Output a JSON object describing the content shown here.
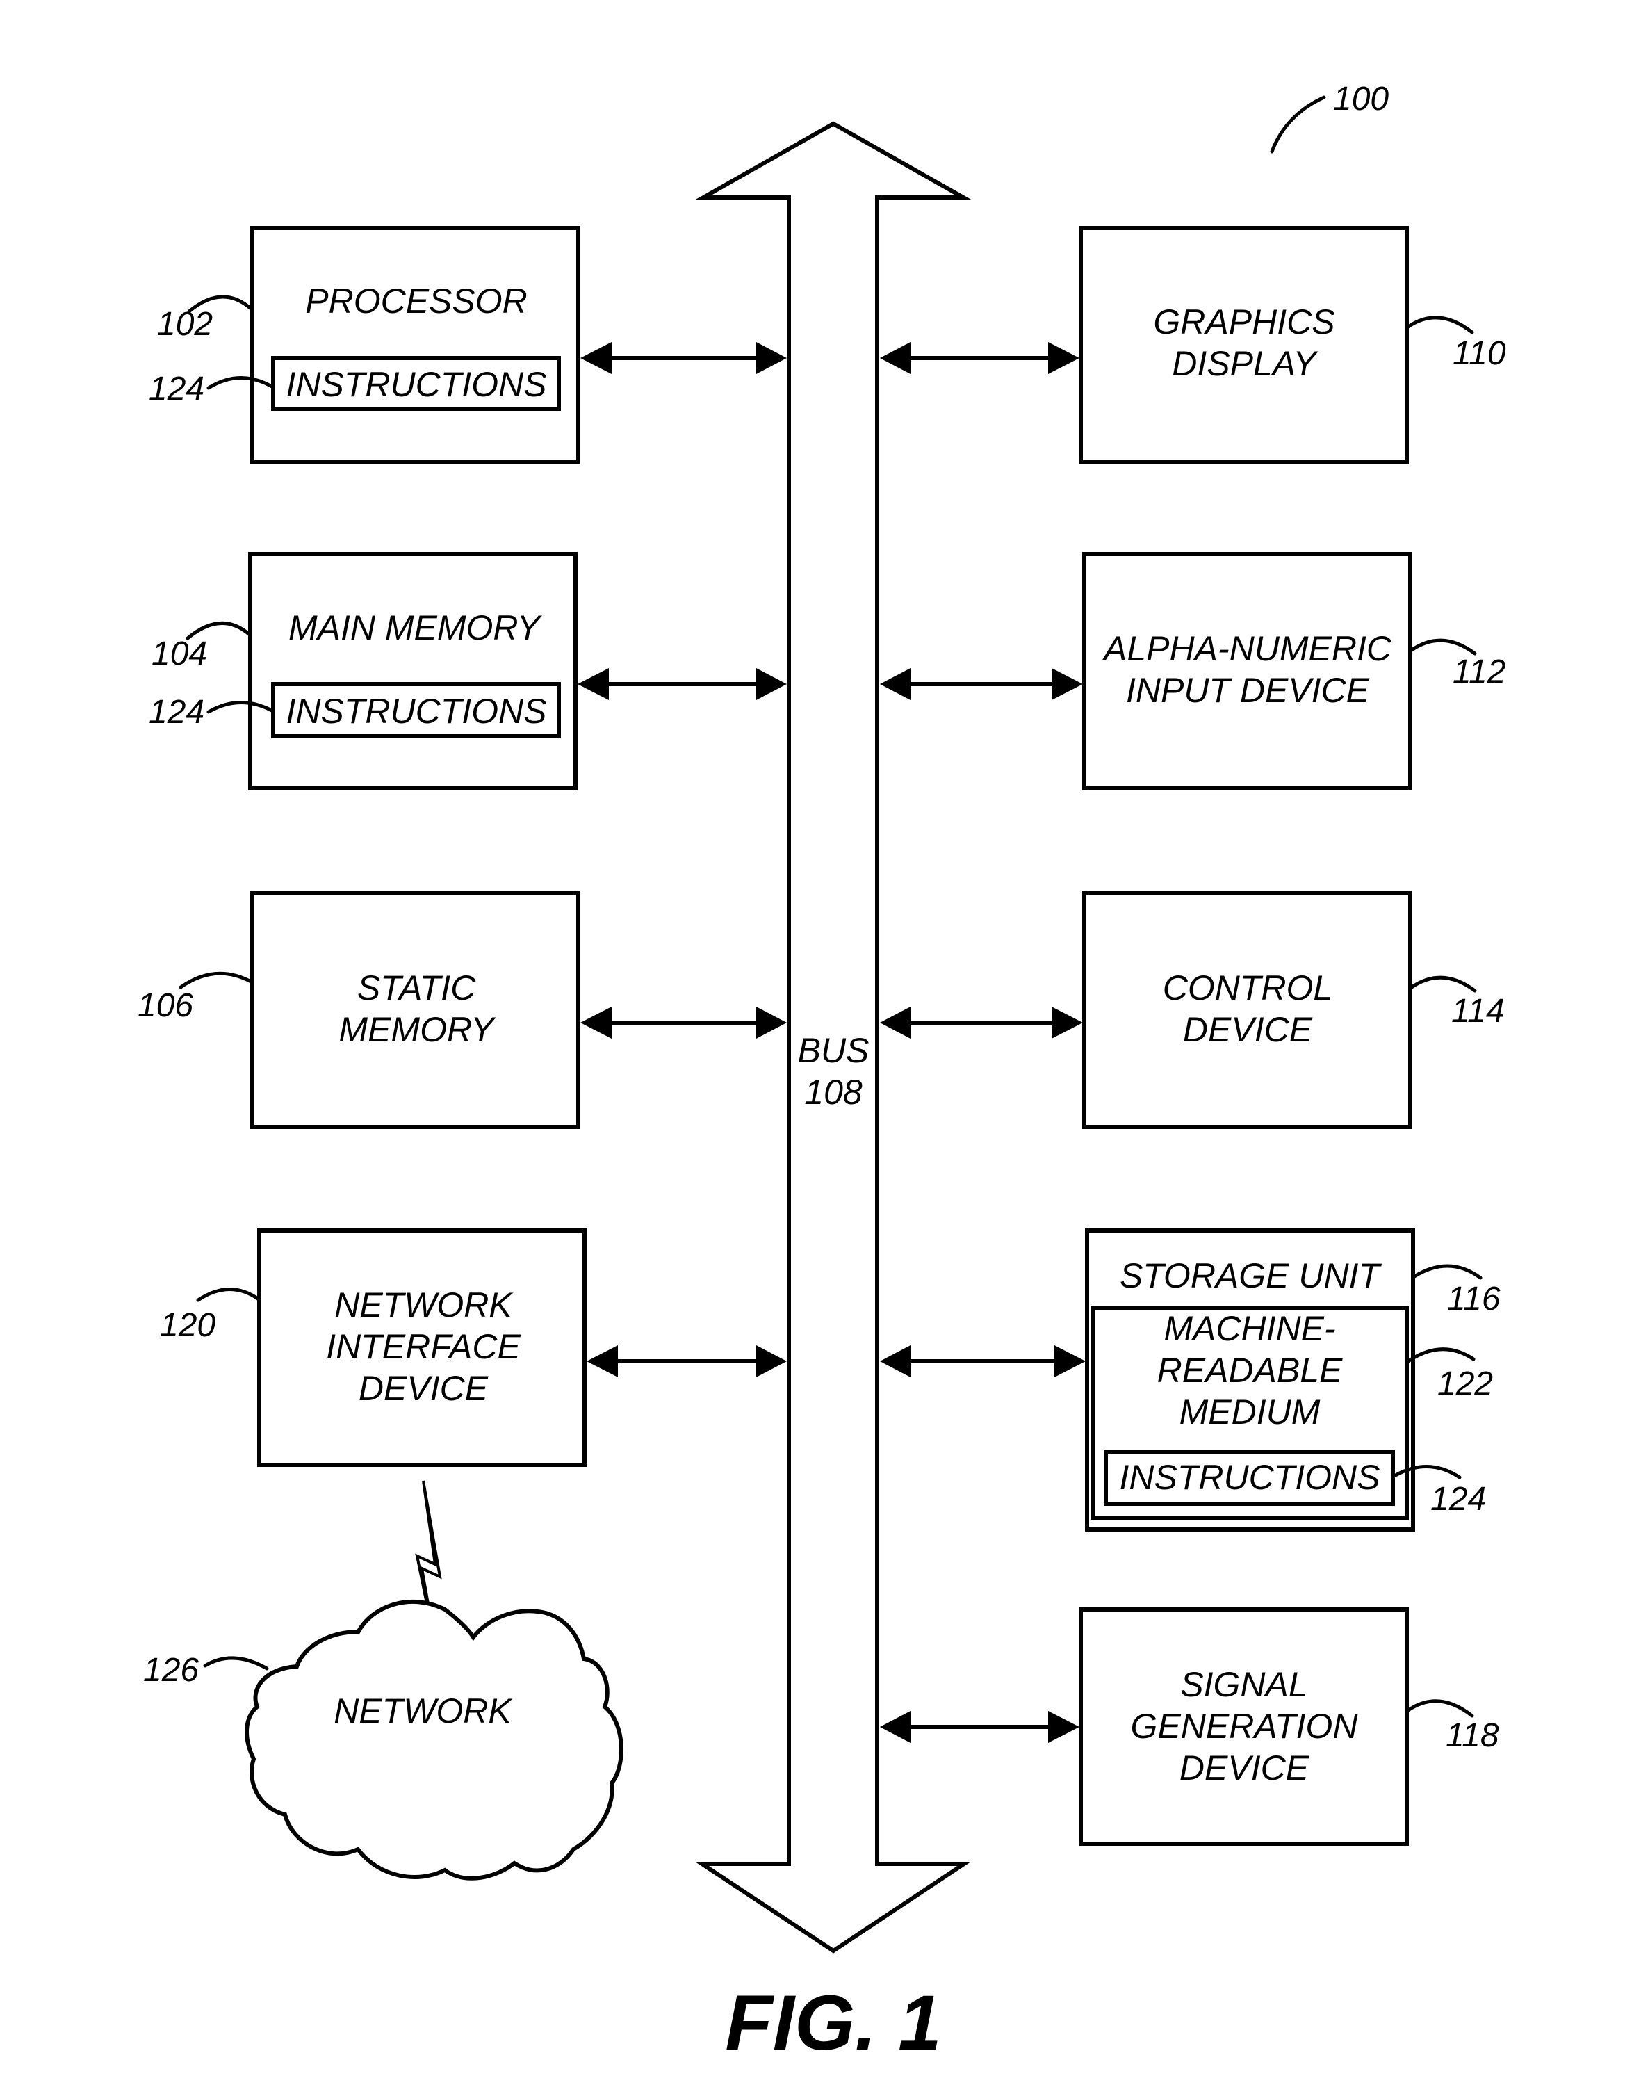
{
  "figure": {
    "caption": "FIG. 1",
    "system_ref": "100"
  },
  "bus": {
    "label": "BUS",
    "ref": "108"
  },
  "components": {
    "processor": {
      "lines": [
        "PROCESSOR"
      ],
      "ref": "102",
      "instructions": {
        "label": "INSTRUCTIONS",
        "ref": "124"
      }
    },
    "main_memory": {
      "lines": [
        "MAIN MEMORY"
      ],
      "ref": "104",
      "instructions": {
        "label": "INSTRUCTIONS",
        "ref": "124"
      }
    },
    "static_memory": {
      "lines": [
        "STATIC",
        "MEMORY"
      ],
      "ref": "106"
    },
    "network_interface": {
      "lines": [
        "NETWORK",
        "INTERFACE",
        "DEVICE"
      ],
      "ref": "120"
    },
    "network": {
      "label": "NETWORK",
      "ref": "126"
    },
    "graphics_display": {
      "lines": [
        "GRAPHICS",
        "DISPLAY"
      ],
      "ref": "110"
    },
    "alphanumeric_input": {
      "lines": [
        "ALPHA-NUMERIC",
        "INPUT DEVICE"
      ],
      "ref": "112"
    },
    "control_device": {
      "lines": [
        "CONTROL",
        "DEVICE"
      ],
      "ref": "114"
    },
    "storage_unit": {
      "lines": [
        "STORAGE UNIT"
      ],
      "ref": "116",
      "medium": {
        "lines": [
          "MACHINE-",
          "READABLE",
          "MEDIUM"
        ],
        "ref": "122"
      },
      "instructions": {
        "label": "INSTRUCTIONS",
        "ref": "124"
      }
    },
    "signal_generation": {
      "lines": [
        "SIGNAL",
        "GENERATION",
        "DEVICE"
      ],
      "ref": "118"
    }
  }
}
